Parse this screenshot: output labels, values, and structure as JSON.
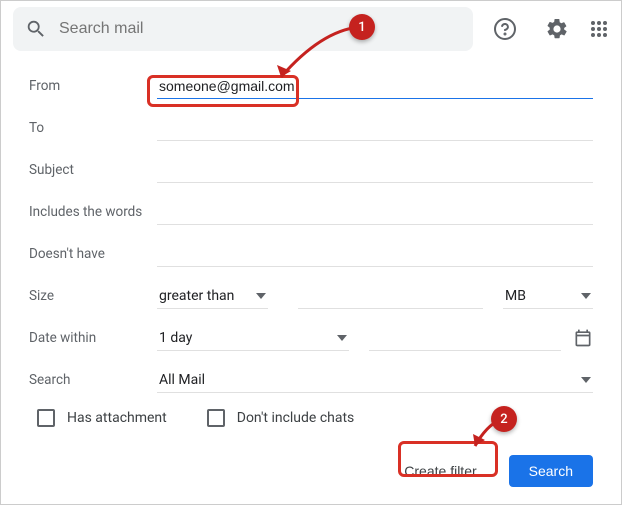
{
  "header": {
    "search_placeholder": "Search mail"
  },
  "filter": {
    "labels": {
      "from": "From",
      "to": "To",
      "subject": "Subject",
      "includes": "Includes the words",
      "doesnt_have": "Doesn't have",
      "size": "Size",
      "date_within": "Date within",
      "search": "Search"
    },
    "values": {
      "from": "someone@gmail.com",
      "size_op": "greater than",
      "size_unit": "MB",
      "date_range": "1 day",
      "search_scope": "All Mail"
    },
    "checkboxes": {
      "has_attachment": "Has attachment",
      "exclude_chats": "Don't include chats"
    },
    "buttons": {
      "create_filter": "Create filter",
      "search": "Search"
    }
  },
  "annotations": {
    "badge1": "1",
    "badge2": "2"
  }
}
